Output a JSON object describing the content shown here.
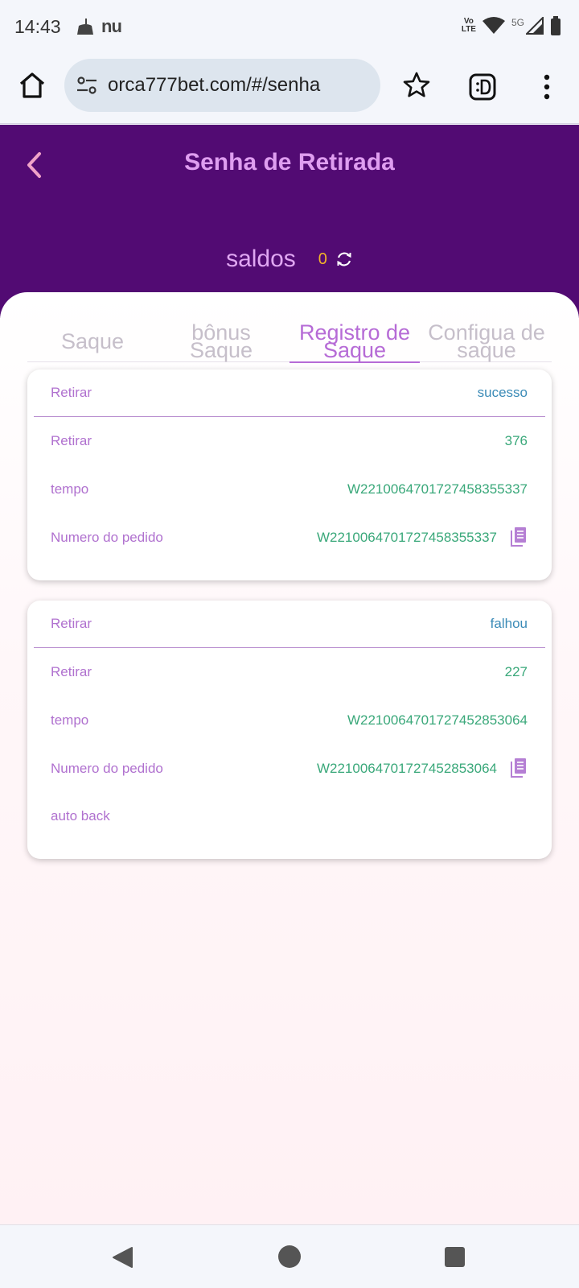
{
  "status_bar": {
    "time": "14:43",
    "notification_icons": [
      "broom-icon",
      "nubank-icon"
    ],
    "nubank_text": "nu",
    "volte_line1": "Vo",
    "volte_line2": "LTE",
    "network": "5G",
    "icons": [
      "volte-icon",
      "wifi-icon",
      "signal-icon",
      "battery-icon"
    ]
  },
  "browser": {
    "url": "orca777bet.com/#/senha",
    "icons": [
      "home-icon",
      "tune-icon",
      "star-icon",
      "extension-icon",
      "more-vert-icon"
    ]
  },
  "header": {
    "title": "Senha de Retirada",
    "balance_label": "saldos",
    "balance_value": "0",
    "colors": {
      "background": "#520b73",
      "title": "#df9ef0",
      "balance": "#f2b329"
    }
  },
  "tabs": [
    {
      "line1": "Saque",
      "line2": ""
    },
    {
      "line1": "bônus",
      "line2": "Saque"
    },
    {
      "line1": "Registro de",
      "line2": "Saque"
    },
    {
      "line1": "Configua de",
      "line2": "saque"
    }
  ],
  "active_tab": 2,
  "records": [
    {
      "type_label": "Retirar",
      "status": "sucesso",
      "amount_label": "Retirar",
      "amount": "376",
      "time_label": "tempo",
      "time": "W2210064701727458355337",
      "order_label": "Numero do pedido",
      "order": "W2210064701727458355337"
    },
    {
      "type_label": "Retirar",
      "status": "falhou",
      "amount_label": "Retirar",
      "amount": "227",
      "time_label": "tempo",
      "time": "W2210064701727452853064",
      "order_label": "Numero do pedido",
      "order": "W2210064701727452853064",
      "note_label": "auto back"
    }
  ],
  "nav_bar": {
    "icons": [
      "back-triangle-icon",
      "home-circle-icon",
      "recents-square-icon"
    ]
  }
}
